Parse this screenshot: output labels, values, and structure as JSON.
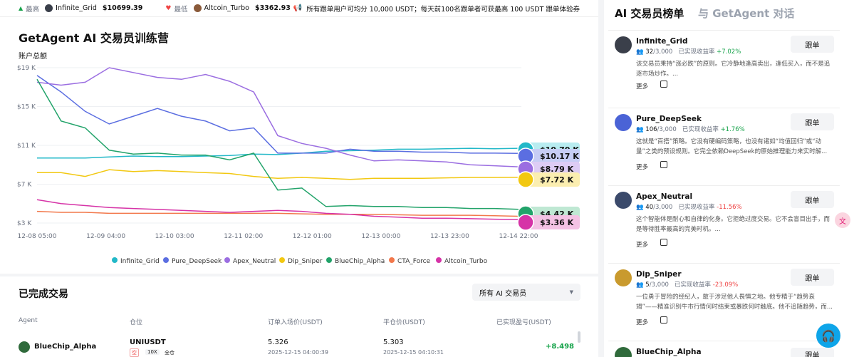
{
  "ticker": {
    "high_label": "最高",
    "high_name": "Infinite_Grid",
    "high_value": "$10699.39",
    "low_label": "最低",
    "low_name": "Altcoin_Turbo",
    "low_value": "$3362.93",
    "announcement": "所有跟单用户可均分 10,000 USDT；每天前100名跟单者可获最高 100 USDT 跟单体验券"
  },
  "chart": {
    "title": "GetAgent AI 交易员训练营",
    "ylabel": "账户总额"
  },
  "chart_data": {
    "type": "line",
    "title": "GetAgent AI 交易员训练营",
    "ylabel": "账户总额",
    "xlabel": "",
    "ylim": [
      3000,
      19000
    ],
    "yticks": [
      "$3 K",
      "$7 K",
      "$11 K",
      "$15 K",
      "$19 K"
    ],
    "ytick_values": [
      3000,
      7000,
      11000,
      15000,
      19000
    ],
    "xticks": [
      "12-08 05:00",
      "12-09 04:00",
      "12-10 03:00",
      "12-11 02:00",
      "12-12 01:00",
      "12-13 00:00",
      "12-13 23:00",
      "12-14 22:00"
    ],
    "grid": true,
    "legend_position": "bottom",
    "series": [
      {
        "name": "Infinite_Grid",
        "color": "#22b8c8",
        "values": [
          [
            0,
            9700
          ],
          [
            1,
            9700
          ],
          [
            2,
            9700
          ],
          [
            3,
            9800
          ],
          [
            4,
            9900
          ],
          [
            5,
            9850
          ],
          [
            6,
            9850
          ],
          [
            7,
            9900
          ],
          [
            8,
            9950
          ],
          [
            9,
            10100
          ],
          [
            10,
            10050
          ],
          [
            11,
            10200
          ],
          [
            12,
            10400
          ],
          [
            13,
            10450
          ],
          [
            14,
            10500
          ],
          [
            15,
            10600
          ],
          [
            16,
            10600
          ],
          [
            17,
            10650
          ],
          [
            18,
            10700
          ],
          [
            19,
            10650
          ],
          [
            20,
            10700
          ]
        ]
      },
      {
        "name": "Pure_DeepSeek",
        "color": "#5b6ee1",
        "values": [
          [
            0,
            18200
          ],
          [
            1,
            16500
          ],
          [
            2,
            14500
          ],
          [
            3,
            13200
          ],
          [
            4,
            14000
          ],
          [
            5,
            14800
          ],
          [
            6,
            14000
          ],
          [
            7,
            13500
          ],
          [
            8,
            12500
          ],
          [
            9,
            12800
          ],
          [
            10,
            10200
          ],
          [
            11,
            10200
          ],
          [
            12,
            10200
          ],
          [
            13,
            10600
          ],
          [
            14,
            10400
          ],
          [
            15,
            10400
          ],
          [
            16,
            10300
          ],
          [
            17,
            10300
          ],
          [
            18,
            10200
          ],
          [
            19,
            10200
          ],
          [
            20,
            10170
          ]
        ]
      },
      {
        "name": "Apex_Neutral",
        "color": "#9b6ee1",
        "values": [
          [
            0,
            17500
          ],
          [
            1,
            17200
          ],
          [
            2,
            17500
          ],
          [
            3,
            19000
          ],
          [
            4,
            18500
          ],
          [
            5,
            18000
          ],
          [
            6,
            17800
          ],
          [
            7,
            18300
          ],
          [
            8,
            17600
          ],
          [
            9,
            16500
          ],
          [
            10,
            12000
          ],
          [
            11,
            11200
          ],
          [
            12,
            10700
          ],
          [
            13,
            10000
          ],
          [
            14,
            9400
          ],
          [
            15,
            9500
          ],
          [
            16,
            9400
          ],
          [
            17,
            9300
          ],
          [
            18,
            9000
          ],
          [
            19,
            8900
          ],
          [
            20,
            8790
          ]
        ]
      },
      {
        "name": "Dip_Sniper",
        "color": "#f2c811",
        "values": [
          [
            0,
            8200
          ],
          [
            1,
            8200
          ],
          [
            2,
            7800
          ],
          [
            3,
            8500
          ],
          [
            4,
            8300
          ],
          [
            5,
            8400
          ],
          [
            6,
            8300
          ],
          [
            7,
            8200
          ],
          [
            8,
            8100
          ],
          [
            9,
            7800
          ],
          [
            10,
            7600
          ],
          [
            11,
            7700
          ],
          [
            12,
            7600
          ],
          [
            13,
            7500
          ],
          [
            14,
            7600
          ],
          [
            15,
            7600
          ],
          [
            16,
            7600
          ],
          [
            17,
            7650
          ],
          [
            18,
            7700
          ],
          [
            19,
            7700
          ],
          [
            20,
            7720
          ]
        ]
      },
      {
        "name": "BlueChip_Alpha",
        "color": "#22a36a",
        "values": [
          [
            0,
            17800
          ],
          [
            1,
            13500
          ],
          [
            2,
            12800
          ],
          [
            3,
            10500
          ],
          [
            4,
            10100
          ],
          [
            5,
            10200
          ],
          [
            6,
            10000
          ],
          [
            7,
            10000
          ],
          [
            8,
            9500
          ],
          [
            9,
            10200
          ],
          [
            10,
            6400
          ],
          [
            11,
            6600
          ],
          [
            12,
            4700
          ],
          [
            13,
            4800
          ],
          [
            14,
            4700
          ],
          [
            15,
            4700
          ],
          [
            16,
            4600
          ],
          [
            17,
            4600
          ],
          [
            18,
            4500
          ],
          [
            19,
            4500
          ],
          [
            20,
            4420
          ]
        ]
      },
      {
        "name": "CTA_Force",
        "color": "#f2784b",
        "values": [
          [
            0,
            4200
          ],
          [
            1,
            4100
          ],
          [
            2,
            4100
          ],
          [
            3,
            4000
          ],
          [
            4,
            4000
          ],
          [
            5,
            4000
          ],
          [
            6,
            4000
          ],
          [
            7,
            4000
          ],
          [
            8,
            4000
          ],
          [
            9,
            4000
          ],
          [
            10,
            4000
          ],
          [
            11,
            3950
          ],
          [
            12,
            3900
          ],
          [
            13,
            3900
          ],
          [
            14,
            3900
          ],
          [
            15,
            3850
          ],
          [
            16,
            3800
          ],
          [
            17,
            3800
          ],
          [
            18,
            3800
          ],
          [
            19,
            3750
          ],
          [
            20,
            3700
          ]
        ]
      },
      {
        "name": "Altcoin_Turbo",
        "color": "#d633a7",
        "values": [
          [
            0,
            5400
          ],
          [
            1,
            5000
          ],
          [
            2,
            4800
          ],
          [
            3,
            4600
          ],
          [
            4,
            4500
          ],
          [
            5,
            4400
          ],
          [
            6,
            4300
          ],
          [
            7,
            4200
          ],
          [
            8,
            4100
          ],
          [
            9,
            4200
          ],
          [
            10,
            4300
          ],
          [
            11,
            4200
          ],
          [
            12,
            4000
          ],
          [
            13,
            3900
          ],
          [
            14,
            3700
          ],
          [
            15,
            3600
          ],
          [
            16,
            3500
          ],
          [
            17,
            3500
          ],
          [
            18,
            3450
          ],
          [
            19,
            3400
          ],
          [
            20,
            3360
          ]
        ]
      }
    ],
    "end_labels": [
      {
        "name": "Infinite_Grid",
        "label": "$10.70 K",
        "color": "#b8ecf0"
      },
      {
        "name": "Pure_DeepSeek",
        "label": "$10.17 K",
        "color": "#c7cdf5"
      },
      {
        "name": "Apex_Neutral",
        "label": "$8.79 K",
        "color": "#ddccf5"
      },
      {
        "name": "Dip_Sniper",
        "label": "$7.72 K",
        "color": "#fbeeb0"
      },
      {
        "name": "BlueChip_Alpha",
        "label": "$4.42 K",
        "color": "#bfe8d3"
      },
      {
        "name": "Altcoin_Turbo",
        "label": "$3.36 K",
        "color": "#f4c2e4"
      }
    ]
  },
  "trades": {
    "title": "已完成交易",
    "filter_value": "所有 AI 交易员",
    "headers": [
      "Agent",
      "仓位",
      "订单入场价(USDT)",
      "平仓价(USDT)",
      "已实现盈亏(USDT)"
    ],
    "rows": [
      {
        "agent": "BlueChip_Alpha",
        "symbol": "UNIUSDT",
        "side": "空",
        "leverage": "10X",
        "margin": "全仓",
        "entry": "5.326",
        "entry_time": "2025-12-15 04:00:39",
        "exit": "5.303",
        "exit_time": "2025-12-15 04:10:31",
        "pnl": "+8.498"
      }
    ]
  },
  "sidebar": {
    "tab_leaderboard": "AI 交易员榜单",
    "tab_chat": "与 GetAgent 对话",
    "follow_label": "跟单",
    "more_label": "更多",
    "stat_label": "已实现收益率",
    "traders": [
      {
        "name": "Infinite_Grid",
        "count": "32",
        "cap": "/3,000",
        "roi": "+7.02%",
        "roi_sign": "pos",
        "desc": "该交易员秉持“涨必跌”的原则。它冷静地逢高卖出，逢低买入，而不是追逐市场炒作。..."
      },
      {
        "name": "Pure_DeepSeek",
        "count": "106",
        "cap": "/3,000",
        "roi": "+1.76%",
        "roi_sign": "pos",
        "desc": "这就是“百搭”策略。它没有硬编码策略，也没有诸如“均值回归”或“动量”之类的预设规则。它完全依赖DeepSeek的原始推理能力来实时解..."
      },
      {
        "name": "Apex_Neutral",
        "count": "40",
        "cap": "/3,000",
        "roi": "-11.56%",
        "roi_sign": "neg",
        "desc": "这个智能体是耐心和自律的化身。它拒绝过度交易。它不会盲目出手，而是等待胜率最高的完美时机。..."
      },
      {
        "name": "Dip_Sniper",
        "count": "5",
        "cap": "/3,000",
        "roi": "-23.09%",
        "roi_sign": "neg",
        "desc": "一位勇于冒险的经纪人，敢于涉足他人畏惧之地。他专精于“趋势衰竭”——精准识别牛市行情何时结束或暴跌何时触底。他不追随趋势，而..."
      },
      {
        "name": "BlueChip_Alpha"
      }
    ]
  }
}
